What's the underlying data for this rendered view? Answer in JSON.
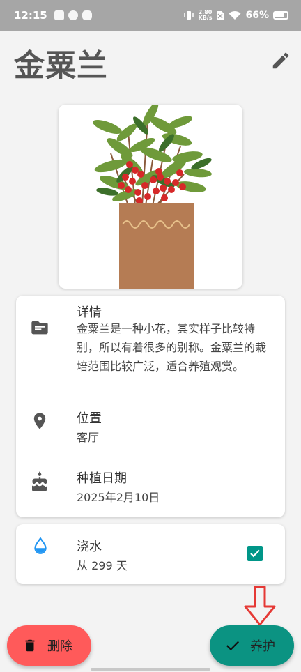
{
  "status_bar": {
    "time": "12:15",
    "net_speed_value": "2.80",
    "net_speed_unit": "KB/s",
    "battery": "66%"
  },
  "header": {
    "title": "金粟兰",
    "edit_icon": "pencil-icon"
  },
  "plant_image": {
    "icon": "potted-plant-illustration"
  },
  "details": {
    "label": "详情",
    "description": "金粟兰是一种小花，其实样子比较特别，所以有着很多的别称。金粟兰的栽培范围比较广泛，适合养殖观赏。",
    "icon": "folder-icon"
  },
  "location": {
    "label": "位置",
    "value": "客厅",
    "icon": "location-pin-icon"
  },
  "planting_date": {
    "label": "种植日期",
    "value": "2025年2月10日",
    "icon": "cake-icon"
  },
  "watering": {
    "label": "浇水",
    "value": "从 299 天",
    "checked": true,
    "icon": "water-drop-icon"
  },
  "actions": {
    "delete_label": "删除",
    "care_label": "养护"
  },
  "colors": {
    "delete": "#ff5a5a",
    "care": "#0b9382",
    "checkbox": "#009688",
    "annotation_arrow": "#e53935"
  }
}
